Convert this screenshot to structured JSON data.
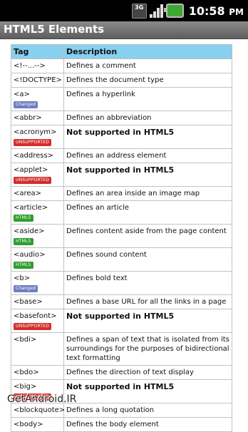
{
  "status": {
    "clock": "10:58",
    "ampm": "PM",
    "network": "3G"
  },
  "title": "HTML5 Elements",
  "table": {
    "headers": [
      "Tag",
      "Description"
    ],
    "rows": [
      {
        "tag": "<!--...-->",
        "desc": "Defines a comment",
        "badge": "",
        "badge_type": "",
        "unsupported": false
      },
      {
        "tag": "<!DOCTYPE>",
        "desc": "Defines the document type",
        "badge": "",
        "badge_type": "",
        "unsupported": false
      },
      {
        "tag": "<a>",
        "desc": "Defines a hyperlink",
        "badge": "Changed",
        "badge_type": "changed",
        "unsupported": false
      },
      {
        "tag": "<abbr>",
        "desc": "Defines an abbreviation",
        "badge": "",
        "badge_type": "",
        "unsupported": false
      },
      {
        "tag": "<acronym>",
        "desc": "Not supported in HTML5",
        "badge": "UNSUPPORTED",
        "badge_type": "unsup",
        "unsupported": true
      },
      {
        "tag": "<address>",
        "desc": "Defines an address element",
        "badge": "",
        "badge_type": "",
        "unsupported": false
      },
      {
        "tag": "<applet>",
        "desc": "Not supported in HTML5",
        "badge": "UNSUPPORTED",
        "badge_type": "unsup",
        "unsupported": true
      },
      {
        "tag": "<area>",
        "desc": "Defines an area inside an image map",
        "badge": "",
        "badge_type": "",
        "unsupported": false
      },
      {
        "tag": "<article>",
        "desc": "Defines an article",
        "badge": "HTML5",
        "badge_type": "html5",
        "unsupported": false
      },
      {
        "tag": "<aside>",
        "desc": "Defines content aside from the page content",
        "badge": "HTML5",
        "badge_type": "html5",
        "unsupported": false
      },
      {
        "tag": "<audio>",
        "desc": "Defines sound content",
        "badge": "HTML5",
        "badge_type": "html5",
        "unsupported": false
      },
      {
        "tag": "<b>",
        "desc": "Defines bold text",
        "badge": "Changed",
        "badge_type": "changed",
        "unsupported": false
      },
      {
        "tag": "<base>",
        "desc": "Defines a base URL for all the links in a page",
        "badge": "",
        "badge_type": "",
        "unsupported": false
      },
      {
        "tag": "<basefont>",
        "desc": "Not supported in HTML5",
        "badge": "UNSUPPORTED",
        "badge_type": "unsup",
        "unsupported": true
      },
      {
        "tag": "<bdi>",
        "desc": "Defines a span of text that is isolated from its surroundings for the purposes of bidirectional text formatting",
        "badge": "",
        "badge_type": "",
        "unsupported": false
      },
      {
        "tag": "<bdo>",
        "desc": "Defines the direction of text display",
        "badge": "",
        "badge_type": "",
        "unsupported": false
      },
      {
        "tag": "<big>",
        "desc": "Not supported in HTML5",
        "badge": "UNSUPPORTED",
        "badge_type": "unsup",
        "unsupported": true
      },
      {
        "tag": "<blockquote>",
        "desc": "Defines a long quotation",
        "badge": "",
        "badge_type": "",
        "unsupported": false
      },
      {
        "tag": "<body>",
        "desc": "Defines the body element",
        "badge": "",
        "badge_type": "",
        "unsupported": false
      }
    ]
  },
  "watermark": "GetAndroid.IR",
  "colors": {
    "header_bg": "#87d0ef",
    "unsupported": "#d32d2d",
    "html5": "#2f9e2f",
    "changed": "#6d7fc2"
  }
}
